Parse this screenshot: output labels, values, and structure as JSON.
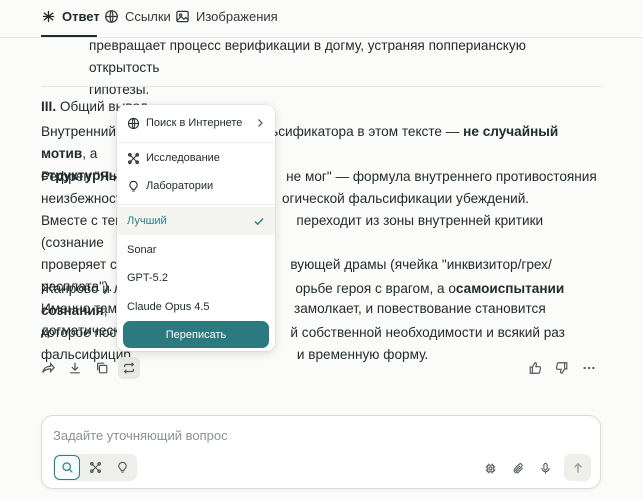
{
  "tabs": [
    {
      "label": "Ответ",
      "icon": "answer-icon",
      "active": true
    },
    {
      "label": "Ссылки",
      "icon": "globe-icon"
    },
    {
      "label": "Изображения",
      "icon": "image-icon"
    }
  ],
  "content": {
    "intro_line1": "превращает процесс верификации в догму, устраняя попперианскую открытость",
    "intro_line2": "гипотезы.",
    "section_num": "III.",
    "section_title": "Общий вывод",
    "p1_line1_start": "Внутренний к",
    "p1_line1_end": "альсификатора в этом тексте —",
    "p1_bold1": "не случайный мотив",
    "p1_comma": ", а",
    "p1_line2": "структурный",
    "p2_line1_start": "Рефрен \"Я ни",
    "p2_line1_end": "не мог\" — формула внутреннего противостояния",
    "p2_line2_start": "неизбежност",
    "p2_line2_end": "огической фальсификации убеждений.",
    "p2_line3_start": "Вместе с тем,",
    "p2_line3_end": "переходит из зоны внутренней критики (сознание",
    "p2_line4_start": "проверяет се",
    "p2_line4_end": "вующей драмы (ячейка \"инквизитор/грех/расплата\").",
    "p2_line5_start": "Именно там в",
    "p2_line5_end": "замолкает, и повествование становится догматическим.",
    "p3_line1_start": "Жанрово и ло",
    "p3_line1_mid": "орьбе героя с врагом, а о",
    "p3_bold": "самоиспытании сознания",
    "p3_line1_end": ",",
    "p3_line2_start": "которое пост",
    "p3_line2_end": "й собственной необходимости и всякий раз",
    "p3_line3_start": "фальсифицир",
    "p3_line3_end": "и временную форму."
  },
  "actions": [
    {
      "name": "share-icon"
    },
    {
      "name": "download-icon"
    },
    {
      "name": "copy-icon"
    },
    {
      "name": "rewrite-icon",
      "selected": true
    },
    {
      "name": "thumbs-up-icon"
    },
    {
      "name": "thumbs-down-icon"
    },
    {
      "name": "more-icon"
    }
  ],
  "dropdown": {
    "web_search": "Поиск в Интернете",
    "research": "Исследование",
    "labs": "Лаборатории",
    "models": [
      {
        "label": "Лучший",
        "selected": true
      },
      {
        "label": "Sonar"
      },
      {
        "label": "GPT-5.2"
      },
      {
        "label": "Claude Opus 4.5"
      }
    ],
    "rewrite_button": "Переписать"
  },
  "ask": {
    "placeholder": "Задайте уточняющий вопрос",
    "value": ""
  },
  "colors": {
    "accent": "#2a8087",
    "button": "#2a7a80",
    "background": "#fbfbf9"
  }
}
